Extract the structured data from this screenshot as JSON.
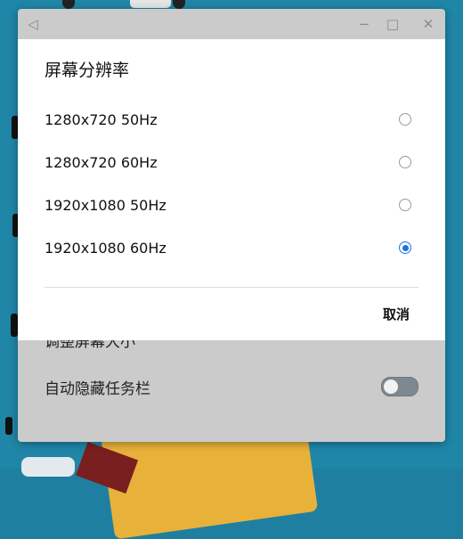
{
  "window": {
    "back_icon": "back-triangle-icon",
    "minimize_icon": "minimize-icon",
    "maximize_icon": "maximize-icon",
    "close_icon": "close-icon",
    "rows": [
      {
        "label": "调整屏幕大小"
      },
      {
        "label": "自动隐藏任务栏",
        "toggle": false
      }
    ]
  },
  "dialog": {
    "title": "屏幕分辨率",
    "options": [
      {
        "label": "1280x720 50Hz",
        "selected": false
      },
      {
        "label": "1280x720 60Hz",
        "selected": false
      },
      {
        "label": "1920x1080 50Hz",
        "selected": false
      },
      {
        "label": "1920x1080 60Hz",
        "selected": true
      }
    ],
    "cancel_label": "取消"
  },
  "colors": {
    "accent": "#1a73e8",
    "wallpaper": "#1f86a8",
    "toggle_off": "#7d8890"
  }
}
